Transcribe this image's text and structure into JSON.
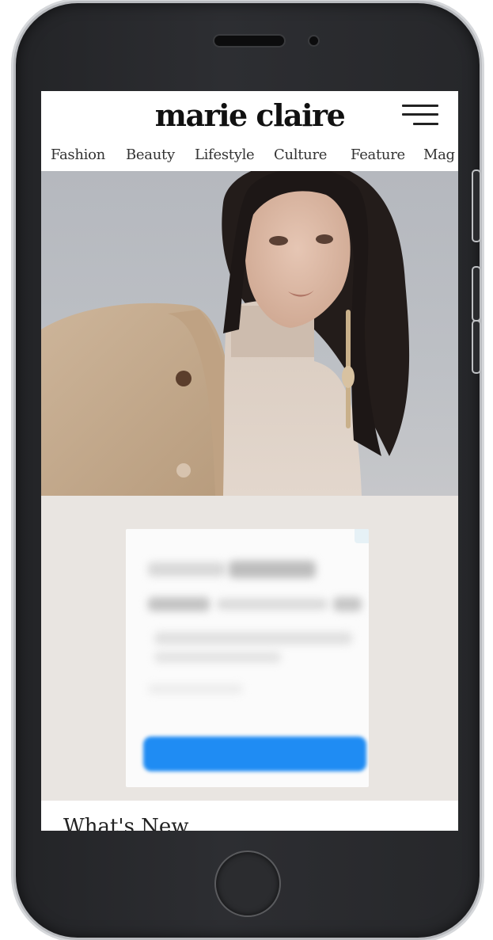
{
  "header": {
    "logo": "marie claire",
    "menu_icon": "hamburger-menu-icon"
  },
  "nav": {
    "items": [
      "Fashion",
      "Beauty",
      "Lifestyle",
      "Culture",
      "Feature",
      "Mag"
    ]
  },
  "hero": {
    "image_subject": "woman in beige trench coat and turtleneck"
  },
  "ad": {
    "cta_color": "#1f8cf3"
  },
  "sections": {
    "whats_new": "What's New"
  },
  "colors": {
    "ad_background": "#e9e5e1",
    "screen_background": "#ffffff",
    "text": "#222222"
  }
}
